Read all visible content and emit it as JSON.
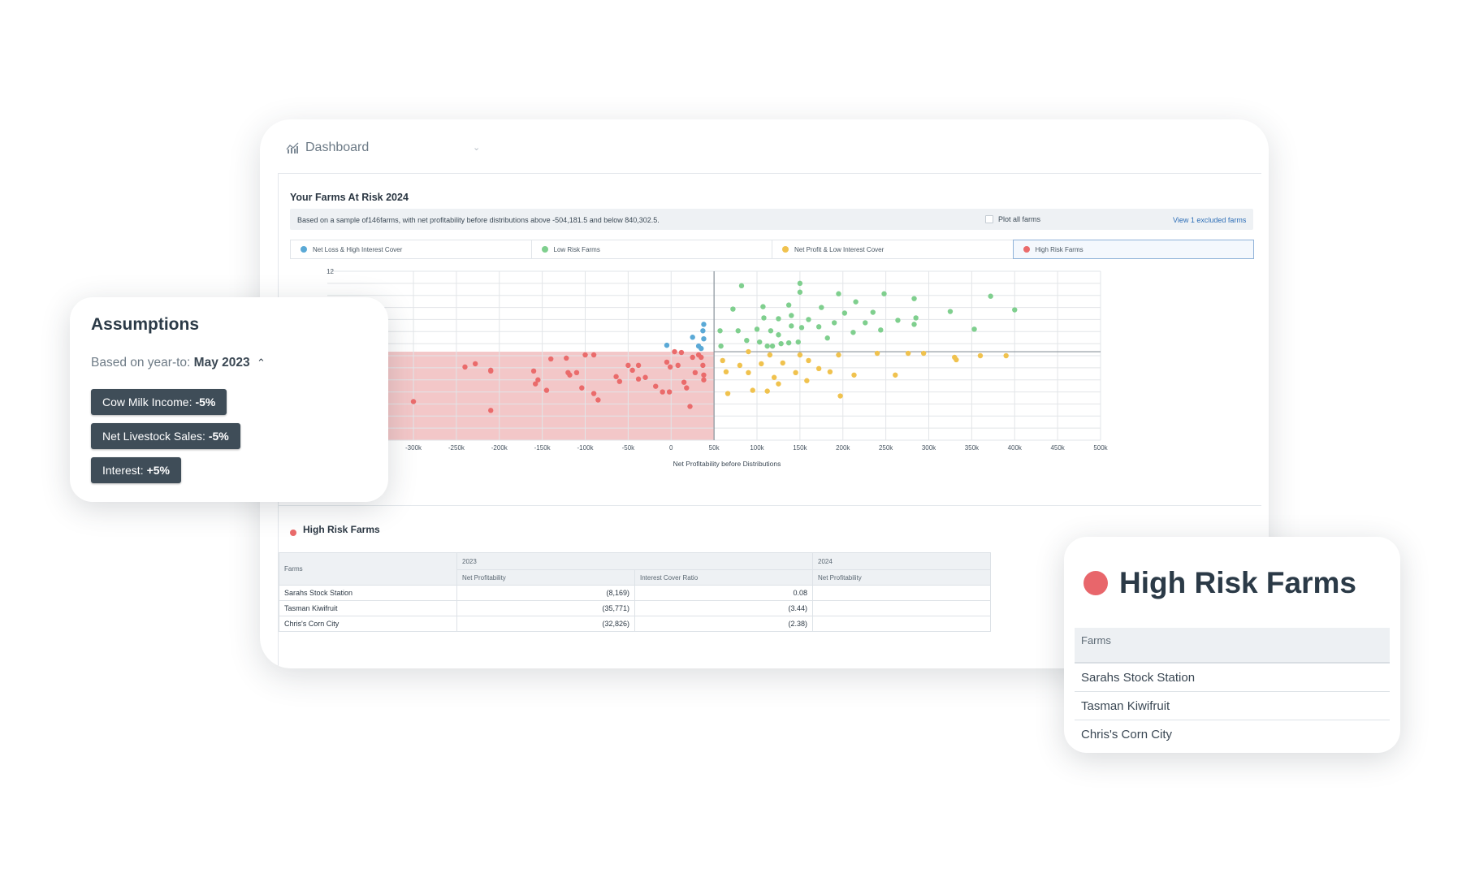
{
  "topbar": {
    "title": "Dashboard"
  },
  "panel": {
    "title": "Your Farms At Risk 2024",
    "sample_text": "Based on a sample of146farms, with net profitability before distributions above -504,181.5 and below 840,302.5.",
    "plot_all_label": "Plot all farms",
    "excluded_link": "View 1 excluded farms"
  },
  "legend": [
    {
      "label": "Net Loss & High Interest Cover",
      "color": "#5aa9d6"
    },
    {
      "label": "Low Risk Farms",
      "color": "#7fcf8e"
    },
    {
      "label": "Net Profit & Low Interest Cover",
      "color": "#f0c24e"
    },
    {
      "label": "High Risk Farms",
      "color": "#ea6b6b",
      "active": true
    }
  ],
  "colors": {
    "red": "#ea6b6b",
    "green": "#7fcf8e",
    "yellow": "#f0c24e",
    "blue": "#5aa9d6",
    "risk_zone": "#f3c7c8"
  },
  "chart_data": {
    "type": "scatter",
    "xlabel": "Net Profitability before Distributions",
    "x_ticks": [
      "-300k",
      "-250k",
      "-200k",
      "-150k",
      "-100k",
      "-50k",
      "0",
      "50k",
      "100k",
      "150k",
      "200k",
      "250k",
      "300k",
      "350k",
      "400k",
      "450k",
      "500k"
    ],
    "x_tick_values": [
      -300000,
      -250000,
      -200000,
      -150000,
      -100000,
      -50000,
      0,
      50000,
      100000,
      150000,
      200000,
      250000,
      300000,
      350000,
      400000,
      450000,
      500000
    ],
    "y_ticks": [
      "12"
    ],
    "xlim": [
      -370000,
      500000
    ],
    "ylim": [
      -9,
      12
    ],
    "grid": true,
    "risk_zone": {
      "x": [
        -370000,
        50000
      ],
      "y": [
        -9,
        2
      ]
    },
    "series": [
      {
        "name": "Net Loss & High Interest Cover",
        "color": "#5aa9d6",
        "points": [
          [
            -5000,
            2.8
          ],
          [
            25000,
            3.8
          ],
          [
            35000,
            2.4
          ],
          [
            37000,
            4.6
          ],
          [
            38000,
            5.4
          ],
          [
            38000,
            3.6
          ],
          [
            32000,
            2.7
          ]
        ]
      },
      {
        "name": "Low Risk Farms",
        "color": "#7fcf8e",
        "points": [
          [
            82000,
            10.2
          ],
          [
            150000,
            10.5
          ],
          [
            72000,
            7.3
          ],
          [
            107000,
            7.6
          ],
          [
            137000,
            7.8
          ],
          [
            150000,
            9.4
          ],
          [
            195000,
            9.2
          ],
          [
            215000,
            8.2
          ],
          [
            108000,
            6.2
          ],
          [
            125000,
            6.1
          ],
          [
            140000,
            6.5
          ],
          [
            160000,
            6.0
          ],
          [
            175000,
            7.5
          ],
          [
            202000,
            6.8
          ],
          [
            235000,
            6.9
          ],
          [
            248000,
            9.2
          ],
          [
            264000,
            5.9
          ],
          [
            283000,
            8.6
          ],
          [
            285000,
            6.2
          ],
          [
            283000,
            5.4
          ],
          [
            325000,
            7.0
          ],
          [
            372000,
            8.9
          ],
          [
            400000,
            7.2
          ],
          [
            353000,
            4.8
          ],
          [
            57000,
            4.6
          ],
          [
            78000,
            4.6
          ],
          [
            100000,
            4.8
          ],
          [
            116000,
            4.6
          ],
          [
            125000,
            4.1
          ],
          [
            140000,
            5.2
          ],
          [
            152000,
            5.0
          ],
          [
            172000,
            5.1
          ],
          [
            190000,
            5.6
          ],
          [
            226000,
            5.6
          ],
          [
            244000,
            4.7
          ],
          [
            103000,
            3.2
          ],
          [
            128000,
            3.0
          ],
          [
            148000,
            3.2
          ],
          [
            182000,
            3.7
          ],
          [
            212000,
            4.4
          ],
          [
            58000,
            2.7
          ],
          [
            88000,
            3.4
          ],
          [
            137000,
            3.1
          ],
          [
            112000,
            2.7
          ],
          [
            118000,
            2.7
          ]
        ]
      },
      {
        "name": "Net Profit & Low Interest Cover",
        "color": "#f0c24e",
        "points": [
          [
            90000,
            2.0
          ],
          [
            115000,
            1.6
          ],
          [
            150000,
            1.6
          ],
          [
            195000,
            1.6
          ],
          [
            240000,
            1.8
          ],
          [
            276000,
            1.8
          ],
          [
            294000,
            1.8
          ],
          [
            330000,
            1.3
          ],
          [
            360000,
            1.5
          ],
          [
            390000,
            1.5
          ],
          [
            60000,
            0.9
          ],
          [
            80000,
            0.3
          ],
          [
            105000,
            0.5
          ],
          [
            130000,
            0.6
          ],
          [
            160000,
            0.9
          ],
          [
            90000,
            -0.6
          ],
          [
            120000,
            -1.2
          ],
          [
            158000,
            -1.6
          ],
          [
            213000,
            -0.9
          ],
          [
            261000,
            -0.9
          ],
          [
            332000,
            1.0
          ],
          [
            64000,
            -0.5
          ],
          [
            66000,
            -3.2
          ],
          [
            95000,
            -2.8
          ],
          [
            112000,
            -2.9
          ],
          [
            125000,
            -2.0
          ],
          [
            172000,
            -0.1
          ],
          [
            185000,
            -0.5
          ],
          [
            197000,
            -3.5
          ],
          [
            145000,
            -0.6
          ]
        ]
      },
      {
        "name": "High Risk Farms",
        "color": "#ea6b6b",
        "points": [
          [
            -300000,
            -4.2
          ],
          [
            -210000,
            -0.3
          ],
          [
            -228000,
            0.5
          ],
          [
            -240000,
            0.1
          ],
          [
            -210000,
            -5.3
          ],
          [
            -160000,
            -0.4
          ],
          [
            -158000,
            -2.0
          ],
          [
            -145000,
            -2.8
          ],
          [
            -122000,
            1.2
          ],
          [
            -120000,
            -0.6
          ],
          [
            -118000,
            -0.9
          ],
          [
            -110000,
            -0.6
          ],
          [
            -104000,
            -2.5
          ],
          [
            -100000,
            1.6
          ],
          [
            -90000,
            -3.2
          ],
          [
            -85000,
            -4.0
          ],
          [
            -64000,
            -1.1
          ],
          [
            -60000,
            -1.7
          ],
          [
            -50000,
            0.3
          ],
          [
            -45000,
            -0.3
          ],
          [
            -38000,
            0.3
          ],
          [
            -38000,
            -1.4
          ],
          [
            -30000,
            -1.2
          ],
          [
            -18000,
            -2.3
          ],
          [
            -10000,
            -3.0
          ],
          [
            -5000,
            0.7
          ],
          [
            -2000,
            -3.0
          ],
          [
            -1000,
            0.1
          ],
          [
            4000,
            2.0
          ],
          [
            8000,
            0.3
          ],
          [
            12000,
            1.9
          ],
          [
            15000,
            -1.8
          ],
          [
            18000,
            -2.5
          ],
          [
            22000,
            -4.8
          ],
          [
            25000,
            1.3
          ],
          [
            28000,
            -0.6
          ],
          [
            32000,
            1.6
          ],
          [
            35000,
            1.3
          ],
          [
            37000,
            0.3
          ],
          [
            38000,
            -1.5
          ],
          [
            38000,
            -0.9
          ],
          [
            -90000,
            1.6
          ],
          [
            -210000,
            -0.4
          ],
          [
            -155000,
            -1.5
          ],
          [
            -140000,
            1.1
          ]
        ]
      }
    ]
  },
  "table": {
    "section_title": "High Risk Farms",
    "farms_header": "Farms",
    "years": [
      "2023",
      "2024"
    ],
    "sub_headers": [
      "Net Profitability",
      "Interest Cover Ratio",
      "Net Profitability"
    ],
    "rows": [
      {
        "name": "Sarahs Stock Station",
        "np2023": "(8,169)",
        "icr2023": "0.08"
      },
      {
        "name": "Tasman Kiwifruit",
        "np2023": "(35,771)",
        "icr2023": "(3.44)"
      },
      {
        "name": "Chris's Corn City",
        "np2023": "(32,826)",
        "icr2023": "(2.38)"
      }
    ]
  },
  "assumptions": {
    "title": "Assumptions",
    "based_prefix": "Based on year-to:",
    "based_value": "May 2023",
    "chips": [
      {
        "label": "Cow Milk Income:",
        "value": "-5%"
      },
      {
        "label": "Net Livestock Sales:",
        "value": "-5%"
      },
      {
        "label": "Interest:",
        "value": "+5%"
      }
    ]
  },
  "hr_card": {
    "title": "High Risk Farms",
    "header": "Farms",
    "rows": [
      "Sarahs Stock Station",
      "Tasman Kiwifruit",
      "Chris's Corn City"
    ]
  }
}
